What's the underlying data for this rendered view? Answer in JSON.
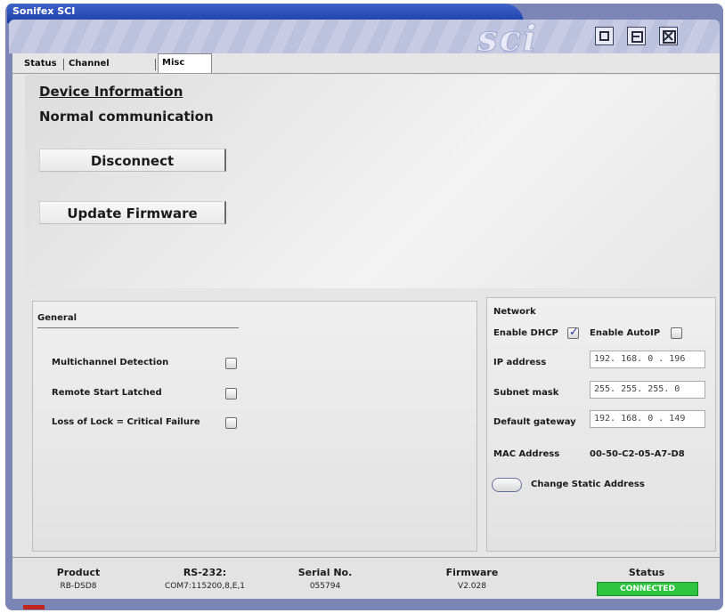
{
  "window": {
    "title": "Sonifex SCI",
    "logo_text": "sci"
  },
  "tabs": [
    {
      "label": "Status",
      "active": false
    },
    {
      "label": "Channel Status",
      "active": false
    },
    {
      "label": "Misc",
      "active": true
    }
  ],
  "device": {
    "heading": "Device Information",
    "comm_status": "Normal communication",
    "disconnect_label": "Disconnect",
    "update_firmware_label": "Update Firmware"
  },
  "general": {
    "title": "General",
    "options": [
      {
        "label": "Multichannel Detection",
        "checked": false
      },
      {
        "label": "Remote Start Latched",
        "checked": false
      },
      {
        "label": "Loss of Lock = Critical Failure",
        "checked": false
      }
    ]
  },
  "network": {
    "title": "Network",
    "enable_dhcp_label": "Enable DHCP",
    "enable_dhcp": true,
    "enable_autoip_label": "Enable AutoIP",
    "enable_autoip": false,
    "ip_label": "IP address",
    "ip_value": "192. 168. 0  . 196",
    "subnet_label": "Subnet mask",
    "subnet_value": "255. 255. 255. 0",
    "gateway_label": "Default gateway",
    "gateway_value": "192. 168. 0  . 149",
    "mac_label": "MAC Address",
    "mac_value": "00-50-C2-05-A7-D8",
    "change_static_label": "Change Static Address"
  },
  "statusbar": {
    "product_label": "Product",
    "product_value": "RB-DSD8",
    "rs232_label": "RS-232:",
    "rs232_value": "COM7:115200,8,E,1",
    "serial_label": "Serial No.",
    "serial_value": "055794",
    "firmware_label": "Firmware",
    "firmware_value": "V2.028",
    "status_label": "Status",
    "status_value": "CONNECTED"
  },
  "colors": {
    "accent": "#7b86b6",
    "titlebar": "#1c3fa8",
    "connected": "#2ec440"
  }
}
